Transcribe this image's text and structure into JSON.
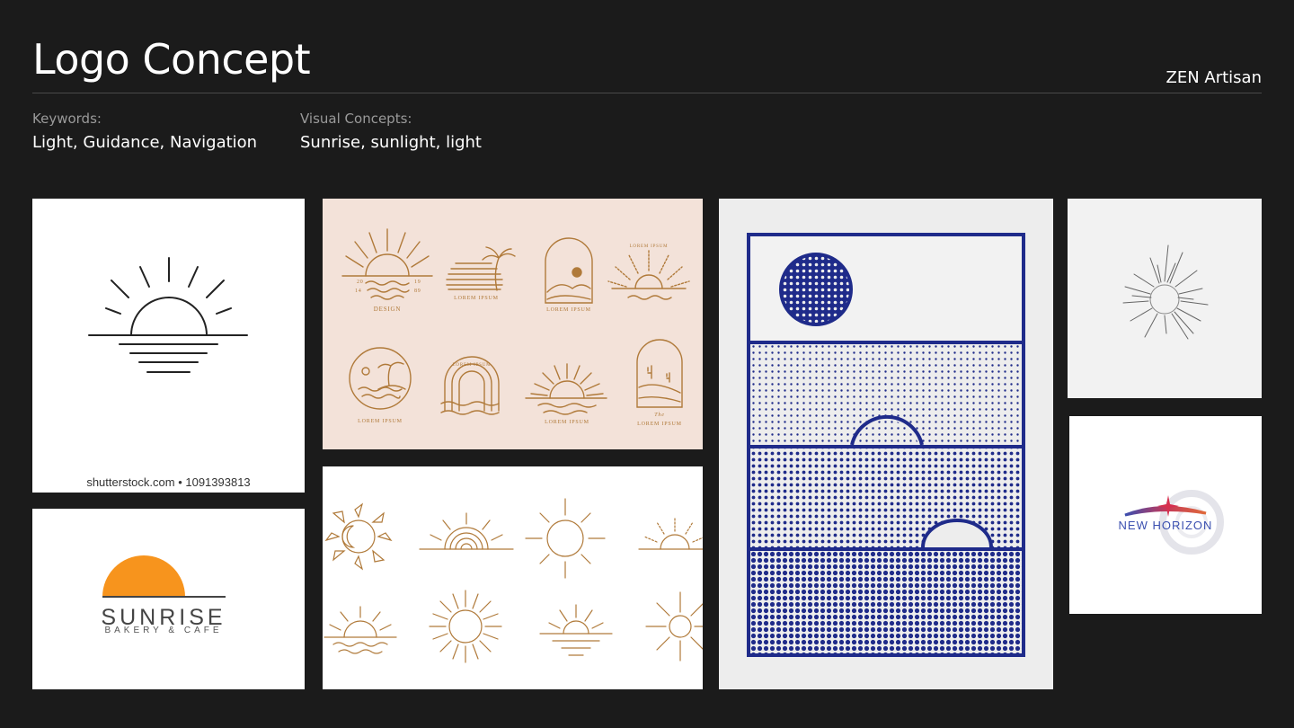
{
  "header": {
    "title": "Logo Concept",
    "brand": "ZEN Artisan"
  },
  "keywords": {
    "label": "Keywords:",
    "value": "Light, Guidance, Navigation"
  },
  "visual_concepts": {
    "label": "Visual Concepts:",
    "value": "Sunrise, sunlight, light"
  },
  "references": {
    "shutterstock": {
      "credit": "shutterstock.com • 1091393813"
    },
    "sunrise_bakery": {
      "name": "SUNRISE",
      "tagline": "BAKERY & CAFE"
    },
    "boho_set": {
      "design": "DESIGN",
      "lorem": "LOREM IPSUM",
      "num_tl": "20",
      "num_bl": "14",
      "num_tr": "19",
      "num_br": "89",
      "script": "The"
    },
    "new_horizon": {
      "name": "NEW HORIZON"
    }
  },
  "colors": {
    "background": "#1b1b1b",
    "bakery_orange": "#f7941d",
    "boho_gold": "#b07a3a",
    "halftone_blue": "#1f2b8a",
    "boho_bg": "#f3e2d9"
  }
}
